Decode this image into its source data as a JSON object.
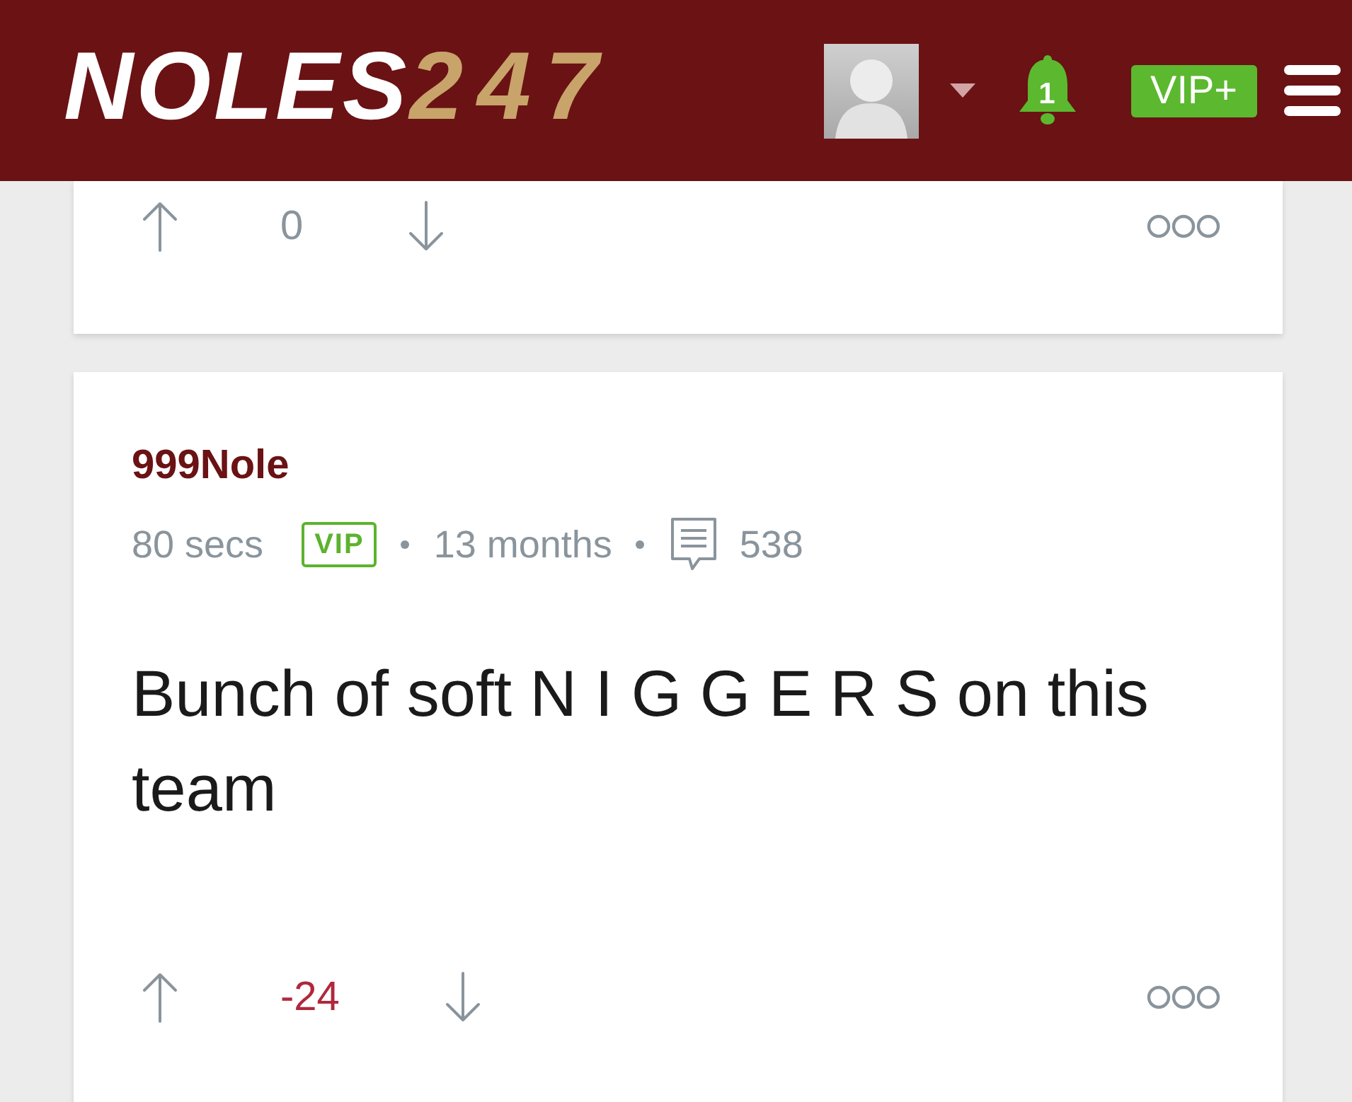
{
  "header": {
    "logo": {
      "text": "NOLES",
      "accent": "247"
    },
    "notifications": {
      "count": "1"
    },
    "vip_button": {
      "label": "VIP+"
    }
  },
  "posts": [
    {
      "score": "0",
      "negative": false
    },
    {
      "author": "999Nole",
      "age": "80 secs",
      "badge": "VIP",
      "member_for": "13 months",
      "post_count": "538",
      "body": "Bunch of soft N I G G E R S on this team",
      "score": "-24",
      "negative": true
    }
  ]
}
